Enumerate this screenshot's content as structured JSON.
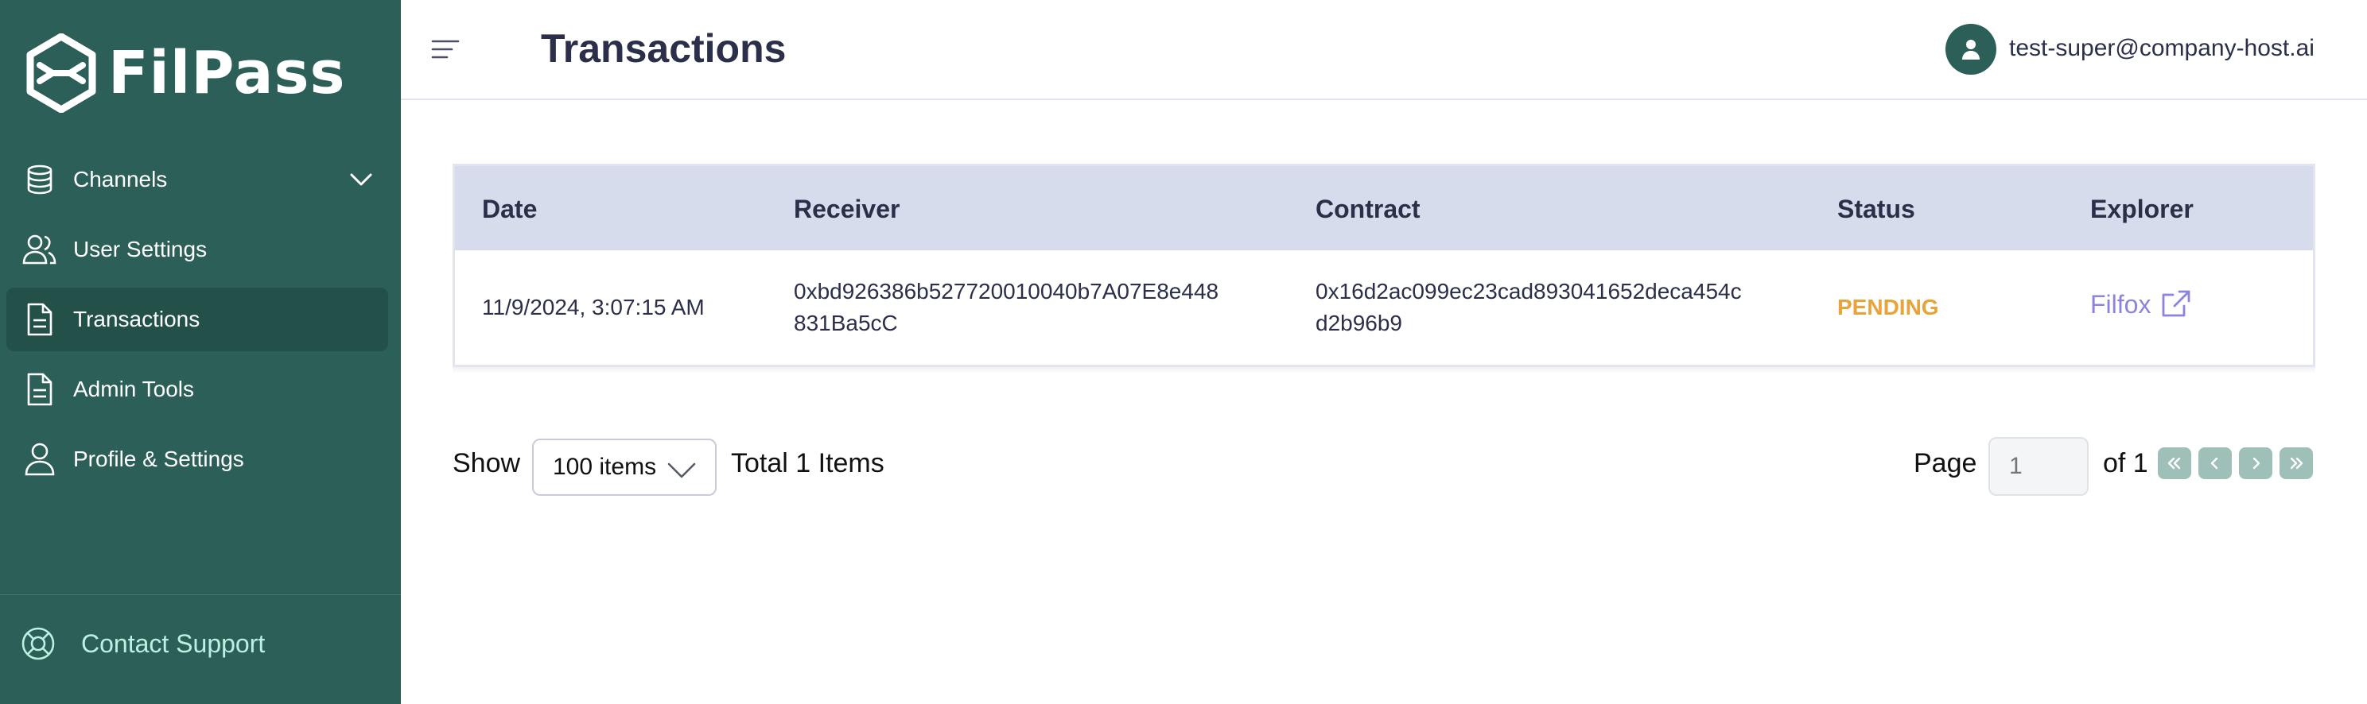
{
  "app": {
    "name": "FilPass"
  },
  "sidebar": {
    "items": [
      {
        "label": "Channels",
        "icon": "database-icon",
        "expandable": true
      },
      {
        "label": "User Settings",
        "icon": "users-icon"
      },
      {
        "label": "Transactions",
        "icon": "document-icon",
        "active": true
      },
      {
        "label": "Admin Tools",
        "icon": "document-icon"
      },
      {
        "label": "Profile & Settings",
        "icon": "user-icon"
      }
    ],
    "support_label": "Contact Support",
    "support_icon": "lifebuoy-icon"
  },
  "header": {
    "title": "Transactions",
    "user_email": "test-super@company-host.ai"
  },
  "table": {
    "columns": [
      "Date",
      "Receiver",
      "Contract",
      "Status",
      "Explorer"
    ],
    "rows": [
      {
        "date": "11/9/2024, 3:07:15 AM",
        "receiver_line1": "0xbd926386b527720010040b7A07E8e448",
        "receiver_line2": "831Ba5cC",
        "contract_line1": "0x16d2ac099ec23cad893041652deca454c",
        "contract_line2": "d2b96b9",
        "status": "PENDING",
        "explorer": "Filfox"
      }
    ]
  },
  "pagination": {
    "show_label": "Show",
    "page_size": "100 items",
    "total_label": "Total 1 Items",
    "page_label": "Page",
    "current_page": "1",
    "of_label": "of 1"
  },
  "colors": {
    "sidebar_bg": "#2c5f57",
    "sidebar_active": "#24504a",
    "table_header_bg": "#d6dcec",
    "status_pending": "#e8a33b",
    "link": "#8b83e0",
    "support_text": "#bfeee2"
  }
}
